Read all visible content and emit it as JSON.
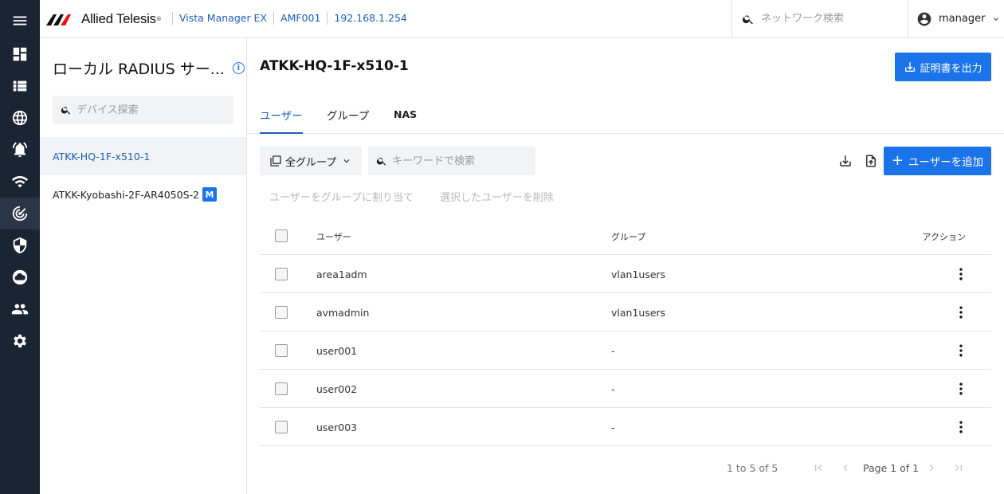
{
  "nav": {
    "items": [
      {
        "icon": "menu-icon"
      },
      {
        "icon": "dashboard-icon"
      },
      {
        "icon": "list-icon"
      },
      {
        "icon": "globe-icon"
      },
      {
        "icon": "alarm-icon"
      },
      {
        "icon": "wifi-icon"
      },
      {
        "icon": "radar-icon",
        "active": true
      },
      {
        "icon": "security-shield-icon"
      },
      {
        "icon": "cloud-icon"
      },
      {
        "icon": "users-icon"
      },
      {
        "icon": "settings-gear-icon"
      }
    ]
  },
  "header": {
    "brand": "Allied Telesis",
    "breadcrumbs": [
      "Vista Manager EX",
      "AMF001",
      "192.168.1.254"
    ],
    "search_placeholder": "ネットワーク検索",
    "user": "manager"
  },
  "sidebar": {
    "title": "ローカル RADIUS サー...",
    "search_placeholder": "デバイス探索",
    "devices": [
      {
        "name": "ATKK-HQ-1F-x510-1",
        "selected": true,
        "badge": ""
      },
      {
        "name": "ATKK-Kyobashi-2F-AR4050S-2",
        "selected": false,
        "badge": "M"
      }
    ]
  },
  "main": {
    "title": "ATKK-HQ-1F-x510-1",
    "export_cert_label": "証明書を出力",
    "tabs": [
      {
        "label": "ユーザー",
        "active": true
      },
      {
        "label": "グループ",
        "active": false
      },
      {
        "label": "NAS",
        "active": false
      }
    ],
    "group_filter": "全グループ",
    "keyword_placeholder": "キーワードで検索",
    "add_user_label": "ユーザーを追加",
    "assign_group_label": "ユーザーをグループに割り当て",
    "delete_selected_label": "選択したユーザーを削除",
    "table": {
      "columns": {
        "user": "ユーザー",
        "group": "グループ",
        "action": "アクション"
      },
      "rows": [
        {
          "user": "area1adm",
          "group": "vlan1users"
        },
        {
          "user": "avmadmin",
          "group": "vlan1users"
        },
        {
          "user": "user001",
          "group": "-"
        },
        {
          "user": "user002",
          "group": "-"
        },
        {
          "user": "user003",
          "group": "-"
        }
      ]
    },
    "pager": {
      "range": "1 to 5 of 5",
      "page": "Page 1 of 1"
    }
  },
  "colors": {
    "nav_bg": "#1b2433",
    "accent": "#1a73e8",
    "link": "#1a5fb4"
  }
}
